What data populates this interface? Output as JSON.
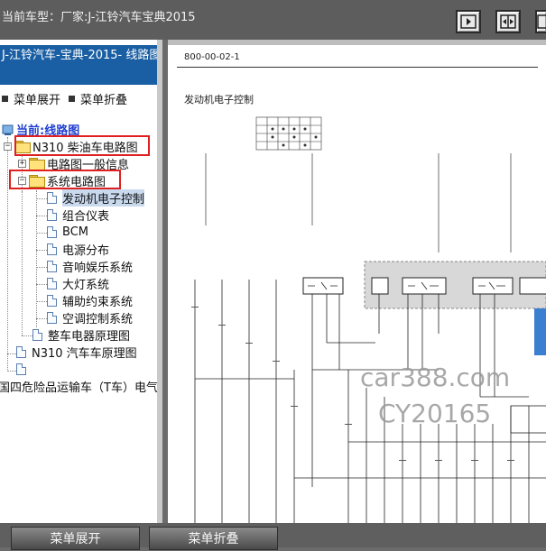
{
  "titlebar": {
    "title": "当前车型：厂家:J-江铃汽车宝典2015"
  },
  "toolbar": {
    "icons": [
      "collapse-right-icon",
      "split-view-icon",
      "fullscreen-icon"
    ]
  },
  "leftpanel": {
    "header": "J-江铃汽车-宝典-2015- 线路图.",
    "menu": {
      "expand": "菜单展开",
      "collapse": "菜单折叠"
    },
    "tree": {
      "root": "当前:线路图",
      "n310_diesel": "N310 柴油车电路图",
      "general_info": "电路图一般信息",
      "system_diagram": "系统电路图",
      "items": [
        "发动机电子控制",
        "组合仪表",
        "BCM",
        "电源分布",
        "音响娱乐系统",
        "大灯系统",
        "辅助约束系统",
        "空调控制系统"
      ],
      "vehicle_principle": "整车电器原理图",
      "n310_principle": "N310 汽车车原理图",
      "blank": "",
      "hazmat": "国四危险品运输车（T车）电气"
    }
  },
  "document": {
    "page_no": "800-00-02-1",
    "section": "发动机电子控制",
    "watermark1": "car388.com",
    "watermark2": "CY20165"
  },
  "bottombar": {
    "expand": "菜单展开",
    "collapse": "菜单折叠"
  },
  "colors": {
    "header_blue": "#1a5fa3",
    "highlight_red": "#e02020",
    "selection": "#c9d9ee"
  }
}
